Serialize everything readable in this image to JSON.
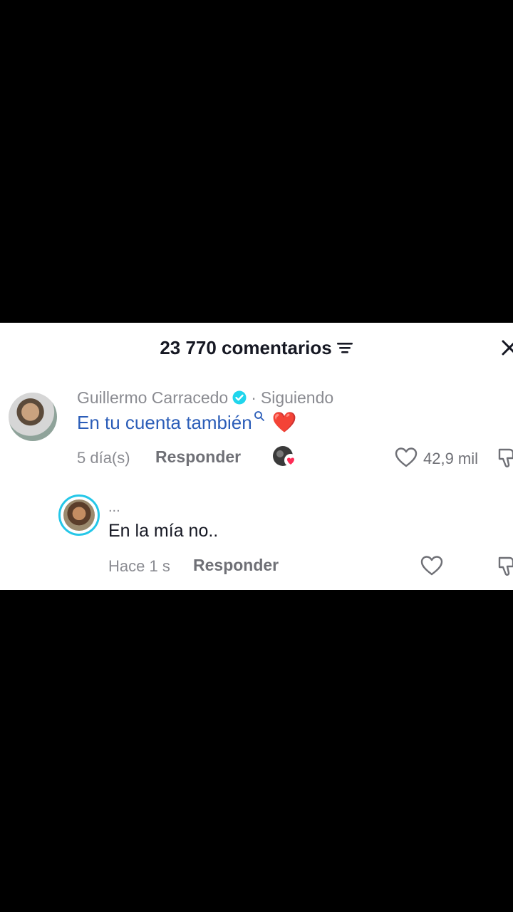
{
  "header": {
    "title": "23 770 comentarios",
    "filter_icon": "filter-icon",
    "close_icon": "close-icon"
  },
  "comment": {
    "username": "Guillermo Carracedo",
    "verified_icon": "verified-badge-icon",
    "separator": "·",
    "following": "Siguiendo",
    "text": "En tu cuenta también",
    "emoji": "❤️",
    "time": "5 día(s)",
    "reply_label": "Responder",
    "likes": "42,9 mil"
  },
  "reply": {
    "username": "...",
    "text": "En la mía no..",
    "time": "Hace 1 s",
    "reply_label": "Responder"
  },
  "colors": {
    "link_blue": "#2b5db8",
    "verified": "#20d5ec",
    "ring": "#25c7e8",
    "creator_heart": "#fe2c55"
  }
}
